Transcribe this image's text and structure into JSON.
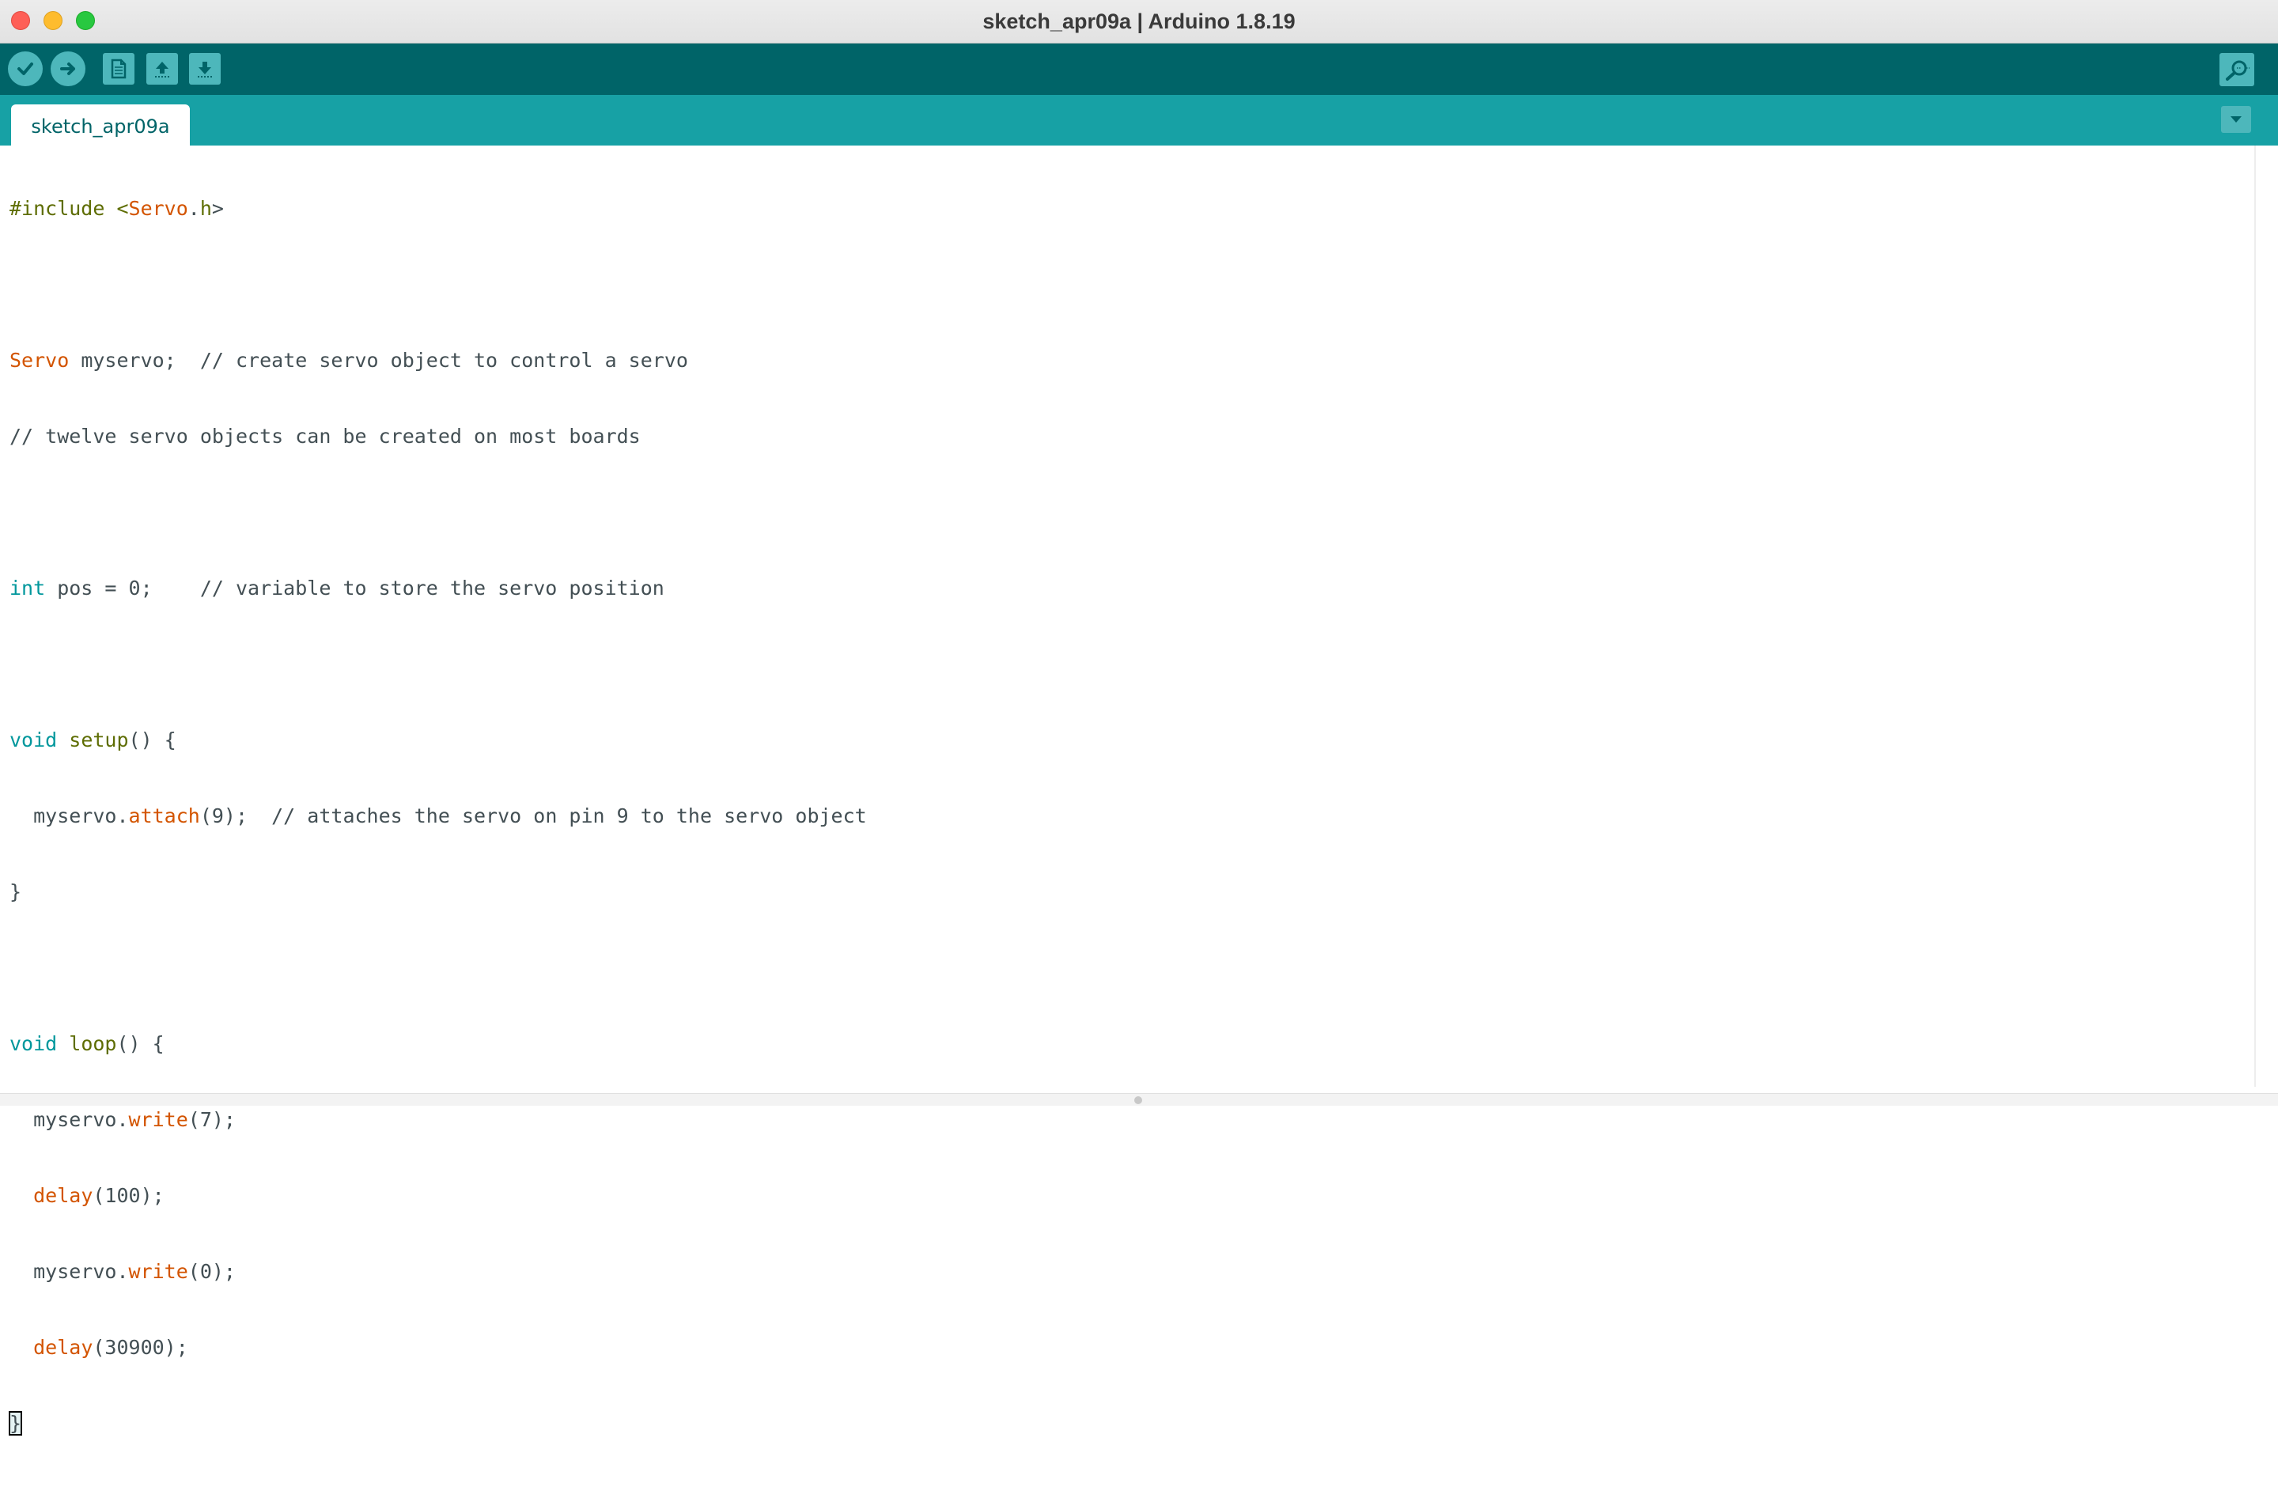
{
  "window": {
    "title": "sketch_apr09a | Arduino 1.8.19"
  },
  "toolbar": {
    "buttons": [
      {
        "name": "verify",
        "icon": "checkmark-icon"
      },
      {
        "name": "upload",
        "icon": "arrow-right-icon"
      },
      {
        "name": "new",
        "icon": "document-icon"
      },
      {
        "name": "open",
        "icon": "arrow-up-icon"
      },
      {
        "name": "save",
        "icon": "arrow-down-icon"
      }
    ],
    "serial_monitor_icon": "magnifier-icon"
  },
  "tabs": [
    {
      "label": "sketch_apr09a",
      "active": true
    }
  ],
  "colors": {
    "toolbar": "#006468",
    "tabbar": "#17a1a5",
    "button": "#4db7bb",
    "keyword": "#00979c",
    "function": "#d35400",
    "preprocessor": "#5e6d03"
  },
  "code": {
    "l1_pre": "#include <",
    "l1_lib": "Servo",
    "l1_dot": ".",
    "l1_h": "h",
    "l1_end": ">",
    "l3_type": "Servo",
    "l3_rest": " myservo;  // create servo object to control a servo",
    "l4": "// twelve servo objects can be created on most boards",
    "l6_kw": "int",
    "l6_rest": " pos = 0;    // variable to store the servo position",
    "l8_kw": "void",
    "l8_sp": " ",
    "l8_fn": "setup",
    "l8_rest": "() {",
    "l9_a": "  myservo.",
    "l9_fn": "attach",
    "l9_rest": "(9);  // attaches the servo on pin 9 to the servo object",
    "l10": "}",
    "l12_kw": "void",
    "l12_sp": " ",
    "l12_fn": "loop",
    "l12_rest": "() {",
    "l13_a": "  myservo.",
    "l13_fn": "write",
    "l13_rest": "(7);",
    "l14_a": "  ",
    "l14_fn": "delay",
    "l14_rest": "(100);",
    "l15_a": "  myservo.",
    "l15_fn": "write",
    "l15_rest": "(0);",
    "l16_a": "  ",
    "l16_fn": "delay",
    "l16_rest": "(30900);",
    "l17": "}"
  }
}
